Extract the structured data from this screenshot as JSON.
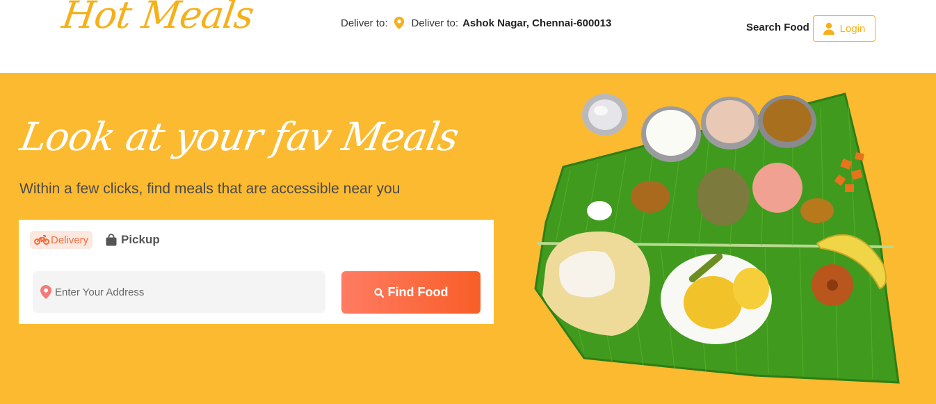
{
  "header": {
    "logo_text": "Hot Meals",
    "deliver_label": "Deliver to:",
    "deliver_label_2": "Deliver to:",
    "deliver_address": "Ashok Nagar, Chennai-600013",
    "search_food": "Search Food",
    "login_label": "Login"
  },
  "hero": {
    "title": "Look at your fav Meals",
    "subtitle": "Within a few clicks, find meals that are accessible near you",
    "tabs": [
      {
        "label": "Delivery",
        "icon": "motorbike-icon",
        "active": true
      },
      {
        "label": "Pickup",
        "icon": "shopping-bag-icon",
        "active": false
      }
    ],
    "address_placeholder": "Enter Your Address",
    "find_button": "Find Food"
  },
  "colors": {
    "brand_yellow": "#f5b01a",
    "hero_bg": "#fcba30",
    "accent_orange": "#f85e27",
    "delivery_tab_bg": "#fde8e0"
  }
}
